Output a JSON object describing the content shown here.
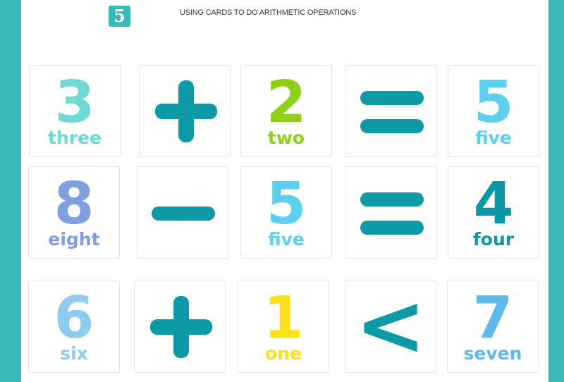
{
  "header": {
    "badge": "5",
    "title": "USING CARDS TO DO ARITHMETIC OPERATIONS"
  },
  "colors": {
    "frame": "#3bb9b6",
    "operator": "#0b9aa6"
  },
  "rows": [
    {
      "cards": [
        {
          "number": "3",
          "word": "three",
          "color": "#6fd9d3"
        },
        {
          "operator": "plus"
        },
        {
          "number": "2",
          "word": "two",
          "color": "#8fd11a"
        },
        {
          "operator": "equals"
        },
        {
          "number": "5",
          "word": "five",
          "color": "#5fcfee"
        }
      ]
    },
    {
      "cards": [
        {
          "number": "8",
          "word": "eight",
          "color": "#7f9fe0"
        },
        {
          "operator": "minus"
        },
        {
          "number": "5",
          "word": "five",
          "color": "#5fcfee"
        },
        {
          "operator": "equals"
        },
        {
          "number": "4",
          "word": "four",
          "color": "#0b97a5"
        }
      ]
    },
    {
      "cards": [
        {
          "number": "6",
          "word": "six",
          "color": "#8ecbee"
        },
        {
          "operator": "plus"
        },
        {
          "number": "1",
          "word": "one",
          "color": "#ffe01a"
        },
        {
          "operator": "less-than",
          "symbol": "<"
        },
        {
          "number": "7",
          "word": "seven",
          "color": "#5db9ea"
        }
      ]
    }
  ]
}
